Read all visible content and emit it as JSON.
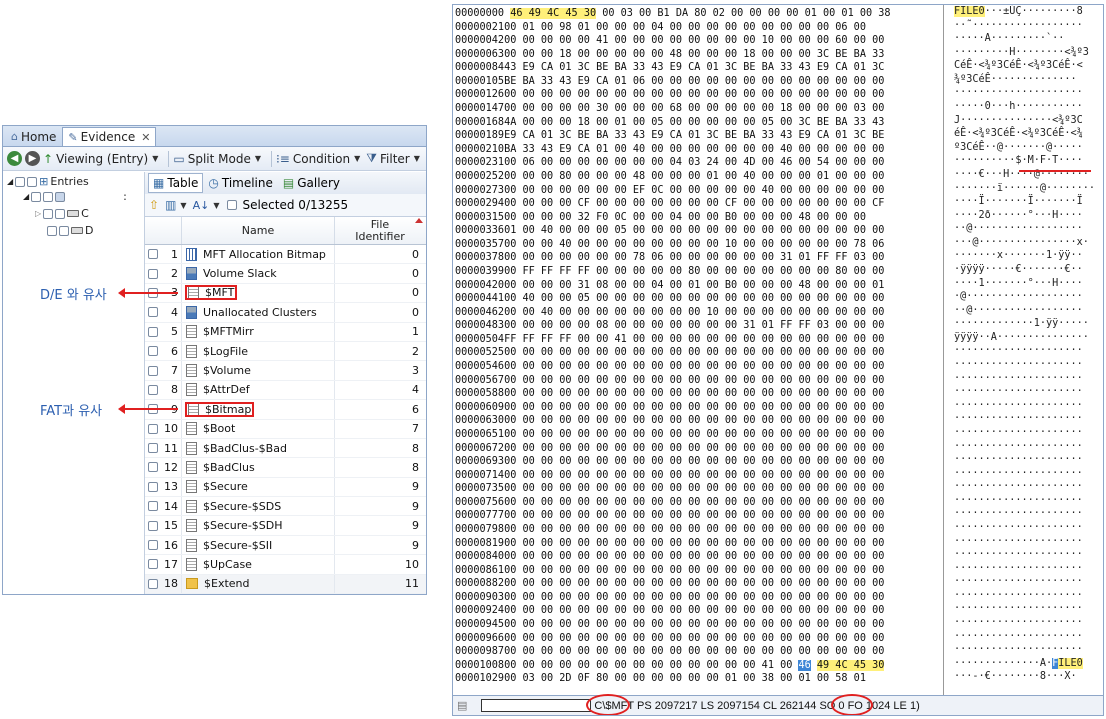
{
  "left_panel": {
    "tabs": [
      {
        "label": "Home"
      },
      {
        "label": "Evidence"
      }
    ],
    "toolbar": {
      "viewing": "Viewing (Entry)",
      "split_mode": "Split Mode",
      "condition": "Condition",
      "filter": "Filter"
    },
    "tree": {
      "root": "Entries",
      "drive_c": "C",
      "drive_d": "D"
    },
    "view_tabs": [
      "Table",
      "Timeline",
      "Gallery"
    ],
    "selected_text": "Selected 0/13255",
    "columns": {
      "name": "Name",
      "file_identifier": "File\nIdentifier"
    },
    "rows": [
      {
        "num": "1",
        "name": "MFT Allocation Bitmap",
        "fid": "0",
        "icon": "bitmap-icon"
      },
      {
        "num": "2",
        "name": "Volume Slack",
        "fid": "0",
        "icon": "slack-icon"
      },
      {
        "num": "3",
        "name": "$MFT",
        "fid": "0",
        "icon": "file-icon"
      },
      {
        "num": "4",
        "name": "Unallocated Clusters",
        "fid": "0",
        "icon": "slack-icon"
      },
      {
        "num": "5",
        "name": "$MFTMirr",
        "fid": "1",
        "icon": "file-icon"
      },
      {
        "num": "6",
        "name": "$LogFile",
        "fid": "2",
        "icon": "file-icon"
      },
      {
        "num": "7",
        "name": "$Volume",
        "fid": "3",
        "icon": "file-icon"
      },
      {
        "num": "8",
        "name": "$AttrDef",
        "fid": "4",
        "icon": "file-icon"
      },
      {
        "num": "9",
        "name": "$Bitmap",
        "fid": "6",
        "icon": "file-icon"
      },
      {
        "num": "10",
        "name": "$Boot",
        "fid": "7",
        "icon": "file-icon"
      },
      {
        "num": "11",
        "name": "$BadClus-$Bad",
        "fid": "8",
        "icon": "file-icon"
      },
      {
        "num": "12",
        "name": "$BadClus",
        "fid": "8",
        "icon": "file-icon"
      },
      {
        "num": "13",
        "name": "$Secure",
        "fid": "9",
        "icon": "file-icon"
      },
      {
        "num": "14",
        "name": "$Secure-$SDS",
        "fid": "9",
        "icon": "file-icon"
      },
      {
        "num": "15",
        "name": "$Secure-$SDH",
        "fid": "9",
        "icon": "file-icon"
      },
      {
        "num": "16",
        "name": "$Secure-$SII",
        "fid": "9",
        "icon": "file-icon"
      },
      {
        "num": "17",
        "name": "$UpCase",
        "fid": "10",
        "icon": "file-icon"
      },
      {
        "num": "18",
        "name": "$Extend",
        "fid": "11",
        "icon": "folder-icon"
      }
    ]
  },
  "annotations": {
    "de": "D/E 와 유사",
    "fat": "FAT과 유사"
  },
  "hex_view": {
    "lines": [
      {
        "off": "00000000",
        "hex": "46 49 4C 45 30 00 03 00 B1 DA 80 02 00 00 00 00 01 00 01 00 38",
        "asc": "FILE0···±ÚÇ·········8"
      },
      {
        "off": "00000021",
        "hex": "00 01 00 98 01 00 00 00 04 00 00 00 00 00 00 00 00 00 06 00",
        "asc": "··˜··················"
      },
      {
        "off": "00000042",
        "hex": "00 00 00 00 00 41 00 00 00 00 00 00 00 00 10 00 00 00 60 00 00",
        "asc": "·····A·········`··"
      },
      {
        "off": "00000063",
        "hex": "00 00 00 18 00 00 00 00 00 48 00 00 00 18 00 00 00 3C BE BA 33",
        "asc": "·········H········<¾º3"
      },
      {
        "off": "00000084",
        "hex": "43 E9 CA 01 3C BE BA 33 43 E9 CA 01 3C BE BA 33 43 E9 CA 01 3C",
        "asc": "CéÊ·<¾º3CéÊ·<¾º3CéÊ·<"
      },
      {
        "off": "00000105",
        "hex": "BE BA 33 43 E9 CA 01 06 00 00 00 00 00 00 00 00 00 00 00 00 00",
        "asc": "¾º3CéÊ··············"
      },
      {
        "off": "00000126",
        "hex": "00 00 00 00 00 00 00 00 00 00 00 00 00 00 00 00 00 00 00 00 00",
        "asc": "·····················"
      },
      {
        "off": "00000147",
        "hex": "00 00 00 00 00 30 00 00 00 68 00 00 00 00 00 18 00 00 00 03 00",
        "asc": "·····0···h···········"
      },
      {
        "off": "00000168",
        "hex": "4A 00 00 00 18 00 01 00 05 00 00 00 00 00 05 00 3C BE BA 33 43",
        "asc": "J···············<¾º3C"
      },
      {
        "off": "00000189",
        "hex": "E9 CA 01 3C BE BA 33 43 E9 CA 01 3C BE BA 33 43 E9 CA 01 3C BE",
        "asc": "éÊ·<¾º3CéÊ·<¾º3CéÊ·<¾"
      },
      {
        "off": "00000210",
        "hex": "BA 33 43 E9 CA 01 00 40 00 00 00 00 00 00 00 40 00 00 00 00 00",
        "asc": "º3CéÊ··@·······@·····"
      },
      {
        "off": "00000231",
        "hex": "00 06 00 00 00 00 00 00 00 04 03 24 00 4D 00 46 00 54 00 00 00",
        "asc": "··········$·M·F·T····"
      },
      {
        "off": "00000252",
        "hex": "00 00 00 80 00 00 00 48 00 00 00 01 00 40 00 00 00 01 00 00 00",
        "asc": "····€···H····@········"
      },
      {
        "off": "00000273",
        "hex": "00 00 00 00 00 00 00 EF 0C 00 00 00 00 00 40 00 00 00 00 00 00",
        "asc": "·······ï······@········"
      },
      {
        "off": "00000294",
        "hex": "00 00 00 00 CF 00 00 00 00 00 00 00 CF 00 00 00 00 00 00 00 CF",
        "asc": "····Ï·······Ï·······Ï"
      },
      {
        "off": "00000315",
        "hex": "00 00 00 00 32 F0 0C 00 00 04 00 00 B0 00 00 00 48 00 00 00",
        "asc": "····2ð······°···H····"
      },
      {
        "off": "00000336",
        "hex": "01 00 40 00 00 00 05 00 00 00 00 00 00 00 00 00 00 00 00 00 00",
        "asc": "··@··················"
      },
      {
        "off": "00000357",
        "hex": "00 00 00 40 00 00 00 00 00 00 00 00 10 00 00 00 00 00 00 78 06",
        "asc": "···@················x·"
      },
      {
        "off": "00000378",
        "hex": "00 00 00 00 00 00 00 78 06 00 00 00 00 00 00 31 01 FF FF 03 00",
        "asc": "·······x·······1·ÿÿ··"
      },
      {
        "off": "00000399",
        "hex": "00 FF FF FF FF 00 00 00 00 00 80 00 00 00 00 00 00 00 80 00 00",
        "asc": "·ÿÿÿÿ·····€·······€··"
      },
      {
        "off": "00000420",
        "hex": "00 00 00 00 31 08 00 00 04 00 01 00 B0 00 00 00 48 00 00 00 01",
        "asc": "····1·······°···H····"
      },
      {
        "off": "00000441",
        "hex": "00 40 00 00 05 00 00 00 00 00 00 00 00 00 00 00 00 00 00 00 00",
        "asc": "·@···················"
      },
      {
        "off": "00000462",
        "hex": "00 00 40 00 00 00 00 00 00 00 00 10 00 00 00 00 00 00 00 00 00",
        "asc": "··@··················"
      },
      {
        "off": "00000483",
        "hex": "00 00 00 00 00 08 00 00 00 00 00 00 00 31 01 FF FF 03 00 00 00",
        "asc": "·············1·ÿÿ·····"
      },
      {
        "off": "00000504",
        "hex": "FF FF FF FF 00 00 41 00 00 00 00 00 00 00 00 00 00 00 00 00 00",
        "asc": "ÿÿÿÿ··A···············"
      },
      {
        "off": "00000525",
        "hex": "00 00 00 00 00 00 00 00 00 00 00 00 00 00 00 00 00 00 00 00 00",
        "asc": "·····················"
      },
      {
        "off": "00000546",
        "hex": "00 00 00 00 00 00 00 00 00 00 00 00 00 00 00 00 00 00 00 00 00",
        "asc": "·····················"
      },
      {
        "off": "00000567",
        "hex": "00 00 00 00 00 00 00 00 00 00 00 00 00 00 00 00 00 00 00 00 00",
        "asc": "·····················"
      },
      {
        "off": "00000588",
        "hex": "00 00 00 00 00 00 00 00 00 00 00 00 00 00 00 00 00 00 00 00 00",
        "asc": "·····················"
      },
      {
        "off": "00000609",
        "hex": "00 00 00 00 00 00 00 00 00 00 00 00 00 00 00 00 00 00 00 00 00",
        "asc": "·····················"
      },
      {
        "off": "00000630",
        "hex": "00 00 00 00 00 00 00 00 00 00 00 00 00 00 00 00 00 00 00 00 00",
        "asc": "·····················"
      },
      {
        "off": "00000651",
        "hex": "00 00 00 00 00 00 00 00 00 00 00 00 00 00 00 00 00 00 00 00 00",
        "asc": "·····················"
      },
      {
        "off": "00000672",
        "hex": "00 00 00 00 00 00 00 00 00 00 00 00 00 00 00 00 00 00 00 00 00",
        "asc": "·····················"
      },
      {
        "off": "00000693",
        "hex": "00 00 00 00 00 00 00 00 00 00 00 00 00 00 00 00 00 00 00 00 00",
        "asc": "·····················"
      },
      {
        "off": "00000714",
        "hex": "00 00 00 00 00 00 00 00 00 00 00 00 00 00 00 00 00 00 00 00 00",
        "asc": "·····················"
      },
      {
        "off": "00000735",
        "hex": "00 00 00 00 00 00 00 00 00 00 00 00 00 00 00 00 00 00 00 00 00",
        "asc": "·····················"
      },
      {
        "off": "00000756",
        "hex": "00 00 00 00 00 00 00 00 00 00 00 00 00 00 00 00 00 00 00 00 00",
        "asc": "·····················"
      },
      {
        "off": "00000777",
        "hex": "00 00 00 00 00 00 00 00 00 00 00 00 00 00 00 00 00 00 00 00 00",
        "asc": "·····················"
      },
      {
        "off": "00000798",
        "hex": "00 00 00 00 00 00 00 00 00 00 00 00 00 00 00 00 00 00 00 00 00",
        "asc": "·····················"
      },
      {
        "off": "00000819",
        "hex": "00 00 00 00 00 00 00 00 00 00 00 00 00 00 00 00 00 00 00 00 00",
        "asc": "·····················"
      },
      {
        "off": "00000840",
        "hex": "00 00 00 00 00 00 00 00 00 00 00 00 00 00 00 00 00 00 00 00 00",
        "asc": "·····················"
      },
      {
        "off": "00000861",
        "hex": "00 00 00 00 00 00 00 00 00 00 00 00 00 00 00 00 00 00 00 00 00",
        "asc": "·····················"
      },
      {
        "off": "00000882",
        "hex": "00 00 00 00 00 00 00 00 00 00 00 00 00 00 00 00 00 00 00 00 00",
        "asc": "·····················"
      },
      {
        "off": "00000903",
        "hex": "00 00 00 00 00 00 00 00 00 00 00 00 00 00 00 00 00 00 00 00 00",
        "asc": "·····················"
      },
      {
        "off": "00000924",
        "hex": "00 00 00 00 00 00 00 00 00 00 00 00 00 00 00 00 00 00 00 00 00",
        "asc": "·····················"
      },
      {
        "off": "00000945",
        "hex": "00 00 00 00 00 00 00 00 00 00 00 00 00 00 00 00 00 00 00 00 00",
        "asc": "·····················"
      },
      {
        "off": "00000966",
        "hex": "00 00 00 00 00 00 00 00 00 00 00 00 00 00 00 00 00 00 00 00 00",
        "asc": "·····················"
      },
      {
        "off": "00000987",
        "hex": "00 00 00 00 00 00 00 00 00 00 00 00 00 00 00 00 00 00 00 00 00",
        "asc": "·····················"
      },
      {
        "off": "00001008",
        "hex": "00 00 00 00 00 00 00 00 00 00 00 00 00 00 41 00 46 49 4C 45 30",
        "asc": "··············A·FILE0"
      },
      {
        "off": "00001029",
        "hex": "00 03 00 2D 0F 80 00 00 00 00 00 00 01 00 38 00 01 00 58 01",
        "asc": "···-·€········8···X·"
      }
    ],
    "status": "C\\$MFT PS 2097217 LS 2097154 CL 262144 SO 0 FO 1024 LE 1)"
  }
}
